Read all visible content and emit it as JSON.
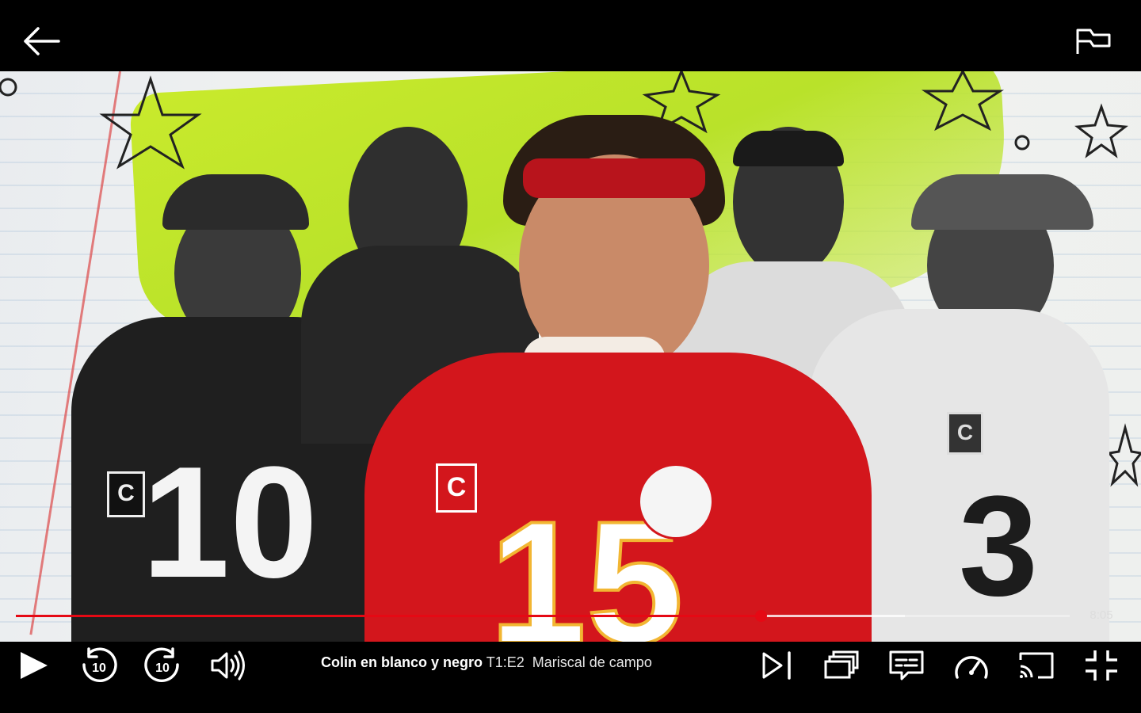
{
  "player": {
    "show_title": "Colin en blanco y negro",
    "episode_code": "T1:E2",
    "episode_title": "Mariscal de campo",
    "time_remaining": "8:05",
    "progress_fraction": 0.7068,
    "buffered_fraction": 0.8436,
    "accent_color": "#e50914"
  },
  "frame": {
    "jersey_numbers": [
      "10",
      "10",
      "15",
      "15",
      "3"
    ],
    "patch_letter": "C"
  },
  "icons": {
    "back": "arrow-left-icon",
    "report": "flag-icon",
    "play": "play-icon",
    "rewind": "rewind-10-icon",
    "forward": "forward-10-icon",
    "volume": "volume-icon",
    "next": "next-episode-icon",
    "episodes": "episodes-icon",
    "subtitles": "subtitles-icon",
    "speed": "playback-speed-icon",
    "cast": "cast-icon",
    "exit_fullscreen": "exit-fullscreen-icon"
  },
  "skip_seconds": "10"
}
